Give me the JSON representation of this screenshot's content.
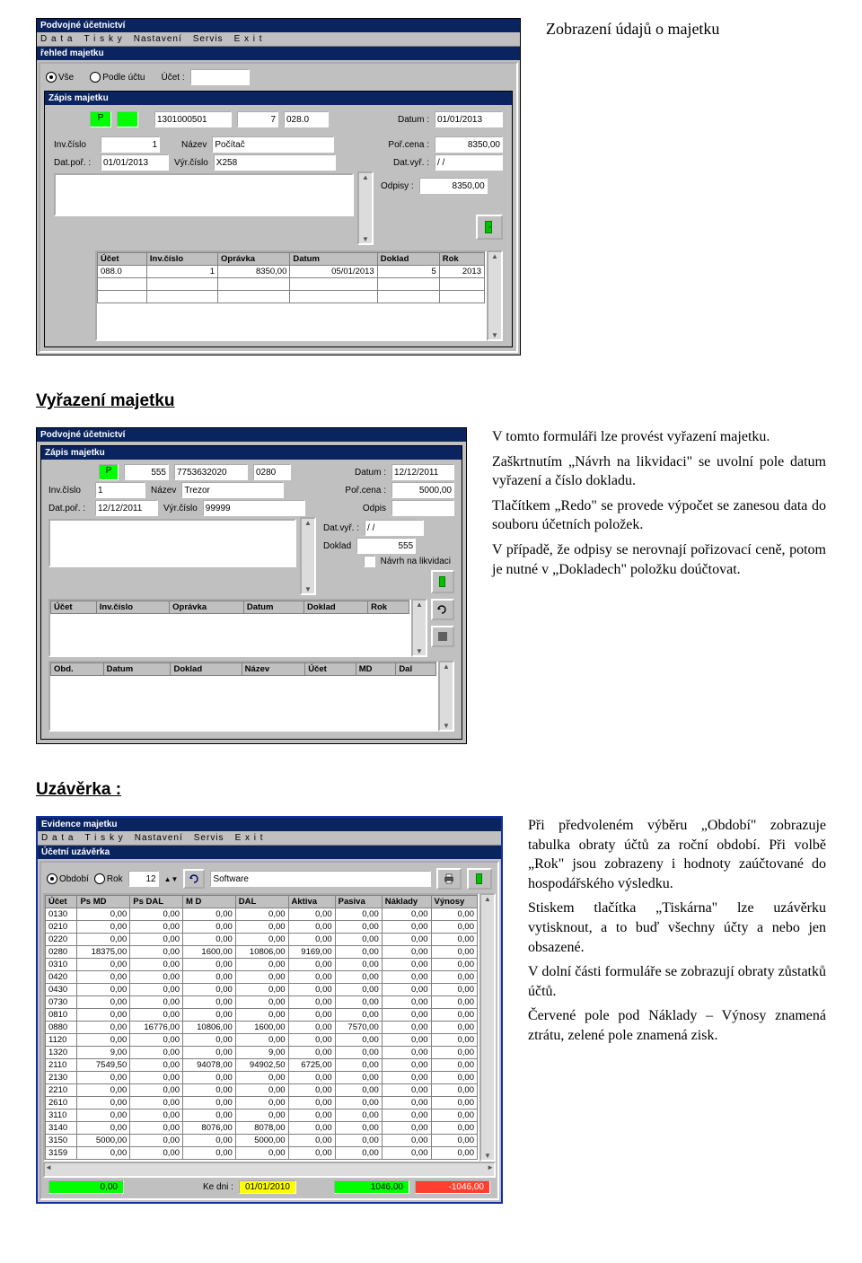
{
  "captions": {
    "display_data": "Zobrazení údajů o majetku",
    "disposal_heading": "Vyřazení majetku",
    "closing_heading": "Uzávěrka :"
  },
  "text_blocks": {
    "disposal": [
      "V tomto formuláři lze provést vyřazení majetku.",
      "Zaškrtnutím „Návrh na likvidaci\" se uvolní pole datum vyřazení a číslo dokladu.",
      "Tlačítkem „Redo\" se provede výpočet se zanesou data do souboru účetních položek.",
      "V případě, že odpisy se nerovnají pořizovací ceně, potom je nutné v „Dokladech\" položku doúčtovat."
    ],
    "closing": [
      "Při předvoleném výběru „Období\" zobrazuje tabulka obraty účtů za roční období. Při volbě „Rok\" jsou zobrazeny i hodnoty zaúčtované do hospodářského výsledku.",
      "Stiskem tlačítka „Tiskárna\" lze uzávěrku vytisknout, a to buď všechny účty a nebo jen obsazené.",
      "V dolní části formuláře se zobrazují obraty zůstatků účtů.",
      "Červené pole pod Náklady – Výnosy znamená ztrátu, zelené pole znamená zisk."
    ]
  },
  "win1": {
    "app_title": "Podvojné účetnictví",
    "menu": [
      "D a t a",
      "T i s k y",
      "Nastavení",
      "Servis",
      "E x i t"
    ],
    "overview_title": "řehled majetku",
    "filter_all": "Vše",
    "filter_by_account": "Podle účtu",
    "account_label": "Účet :",
    "entry_title": "Zápis majetku",
    "p_label": "P",
    "p_val": "",
    "v1": "1301000501",
    "v2": "7",
    "v3": "028.0",
    "date_label": "Datum :",
    "date_val": "01/01/2013",
    "inv_label": "Inv.číslo",
    "inv_val": "1",
    "name_label": "Název",
    "name_val": "Počítač",
    "price_label": "Poř.cena :",
    "price_val": "8350,00",
    "acq_label": "Dat.poř. :",
    "acq_val": "01/01/2013",
    "mfg_label": "Výr.číslo",
    "mfg_val": "X258",
    "disposal_label": "Dat.vyř. :",
    "disposal_val": "/ /",
    "depr_label": "Odpisy :",
    "depr_val": "8350,00",
    "grid": {
      "headers": [
        "Účet",
        "Inv.číslo",
        "Oprávka",
        "Datum",
        "Doklad",
        "Rok"
      ],
      "rows": [
        [
          "088.0",
          "1",
          "8350,00",
          "05/01/2013",
          "5",
          "2013"
        ]
      ]
    }
  },
  "win2": {
    "app_title": "Podvojné účetnictví",
    "entry_title": "Zápis majetku",
    "p_label": "P",
    "v1": "555",
    "v2": "7753632020",
    "v3": "0280",
    "date_label": "Datum :",
    "date_val": "12/12/2011",
    "inv_label": "Inv.číslo",
    "inv_val": "1",
    "name_label": "Název",
    "name_val": "Trezor",
    "price_label": "Poř.cena :",
    "price_val": "5000,00",
    "acq_label": "Dat.poř. :",
    "acq_val": "12/12/2011",
    "mfg_label": "Výr.číslo",
    "mfg_val": "99999",
    "depr_label": "Odpis",
    "disposal_label": "Dat.vyř. :",
    "disposal_val": "/ /",
    "doc_label": "Doklad",
    "doc_val": "555",
    "liq_label": "Návrh na likvidaci",
    "grid1": {
      "headers": [
        "Účet",
        "Inv.číslo",
        "Oprávka",
        "Datum",
        "Doklad",
        "Rok"
      ]
    },
    "grid2": {
      "headers": [
        "Obd.",
        "Datum",
        "Doklad",
        "Název",
        "Účet",
        "MD",
        "Dal"
      ]
    }
  },
  "win3": {
    "app_title": "Evidence majetku",
    "menu": [
      "D a t a",
      "T i s k y",
      "Nastavení",
      "Servis",
      "E x i t"
    ],
    "panel_title": "Účetní uzávěrka",
    "obdobi": "Období",
    "rok": "Rok",
    "period_val": "12",
    "group_val": "Software",
    "grid": {
      "headers": [
        "Účet",
        "Ps MD",
        "Ps DAL",
        "M D",
        "DAL",
        "Aktiva",
        "Pasiva",
        "Náklady",
        "Výnosy"
      ],
      "rows": [
        [
          "0130",
          "0,00",
          "0,00",
          "0,00",
          "0,00",
          "0,00",
          "0,00",
          "0,00",
          "0,00"
        ],
        [
          "0210",
          "0,00",
          "0,00",
          "0,00",
          "0,00",
          "0,00",
          "0,00",
          "0,00",
          "0,00"
        ],
        [
          "0220",
          "0,00",
          "0,00",
          "0,00",
          "0,00",
          "0,00",
          "0,00",
          "0,00",
          "0,00"
        ],
        [
          "0280",
          "18375,00",
          "0,00",
          "1600,00",
          "10806,00",
          "9169,00",
          "0,00",
          "0,00",
          "0,00"
        ],
        [
          "0310",
          "0,00",
          "0,00",
          "0,00",
          "0,00",
          "0,00",
          "0,00",
          "0,00",
          "0,00"
        ],
        [
          "0420",
          "0,00",
          "0,00",
          "0,00",
          "0,00",
          "0,00",
          "0,00",
          "0,00",
          "0,00"
        ],
        [
          "0430",
          "0,00",
          "0,00",
          "0,00",
          "0,00",
          "0,00",
          "0,00",
          "0,00",
          "0,00"
        ],
        [
          "0730",
          "0,00",
          "0,00",
          "0,00",
          "0,00",
          "0,00",
          "0,00",
          "0,00",
          "0,00"
        ],
        [
          "0810",
          "0,00",
          "0,00",
          "0,00",
          "0,00",
          "0,00",
          "0,00",
          "0,00",
          "0,00"
        ],
        [
          "0880",
          "0,00",
          "16776,00",
          "10806,00",
          "1600,00",
          "0,00",
          "7570,00",
          "0,00",
          "0,00"
        ],
        [
          "1120",
          "0,00",
          "0,00",
          "0,00",
          "0,00",
          "0,00",
          "0,00",
          "0,00",
          "0,00"
        ],
        [
          "1320",
          "9,00",
          "0,00",
          "0,00",
          "9,00",
          "0,00",
          "0,00",
          "0,00",
          "0,00"
        ],
        [
          "2110",
          "7549,50",
          "0,00",
          "94078,00",
          "94902,50",
          "6725,00",
          "0,00",
          "0,00",
          "0,00"
        ],
        [
          "2130",
          "0,00",
          "0,00",
          "0,00",
          "0,00",
          "0,00",
          "0,00",
          "0,00",
          "0,00"
        ],
        [
          "2210",
          "0,00",
          "0,00",
          "0,00",
          "0,00",
          "0,00",
          "0,00",
          "0,00",
          "0,00"
        ],
        [
          "2610",
          "0,00",
          "0,00",
          "0,00",
          "0,00",
          "0,00",
          "0,00",
          "0,00",
          "0,00"
        ],
        [
          "3110",
          "0,00",
          "0,00",
          "0,00",
          "0,00",
          "0,00",
          "0,00",
          "0,00",
          "0,00"
        ],
        [
          "3140",
          "0,00",
          "0,00",
          "8076,00",
          "8078,00",
          "0,00",
          "0,00",
          "0,00",
          "0,00"
        ],
        [
          "3150",
          "5000,00",
          "0,00",
          "0,00",
          "5000,00",
          "0,00",
          "0,00",
          "0,00",
          "0,00"
        ],
        [
          "3159",
          "0,00",
          "0,00",
          "0,00",
          "0,00",
          "0,00",
          "0,00",
          "0,00",
          "0,00"
        ]
      ]
    },
    "footer": {
      "val1": "0,00",
      "kedni_label": "Ke dni :",
      "kedni_val": "01/01/2010",
      "val2": "1046,00",
      "val3": "-1046,00"
    }
  }
}
